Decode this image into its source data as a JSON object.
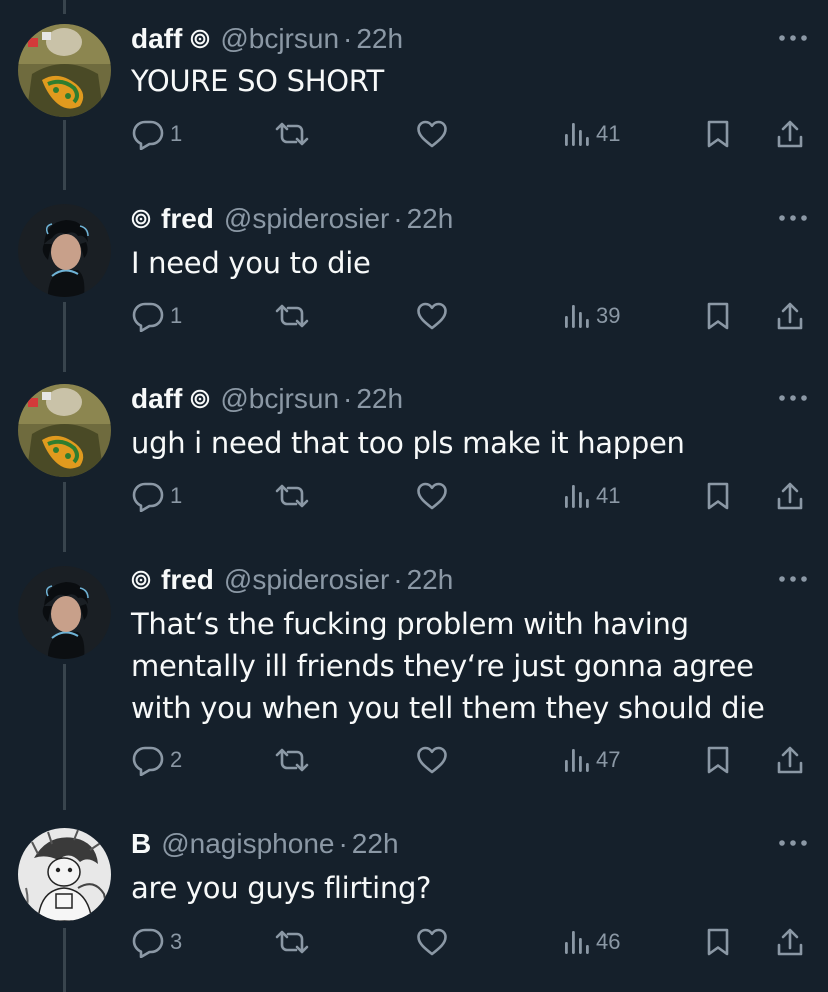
{
  "colors": {
    "background": "#15202b",
    "text": "#f7f9f9",
    "secondary": "#8b98a5",
    "thread_line": "#38444d"
  },
  "tweets": [
    {
      "name": "daff",
      "handle": "@bcjrsun",
      "separator": "·",
      "time": "22h",
      "badge": "spiral-icon",
      "badge_position": "after",
      "text": "YOURE SO SHORT",
      "replies": "1",
      "views": "41",
      "avatar": "avatar-daff"
    },
    {
      "name": "fred",
      "handle": "@spiderosier",
      "separator": "·",
      "time": "22h",
      "badge": "spiral-icon",
      "badge_position": "before",
      "text": "I need you to die",
      "replies": "1",
      "views": "39",
      "avatar": "avatar-fred"
    },
    {
      "name": "daff",
      "handle": "@bcjrsun",
      "separator": "·",
      "time": "22h",
      "badge": "spiral-icon",
      "badge_position": "after",
      "text": "ugh i need that too pls make it happen",
      "replies": "1",
      "views": "41",
      "avatar": "avatar-daff"
    },
    {
      "name": "fred",
      "handle": "@spiderosier",
      "separator": "·",
      "time": "22h",
      "badge": "spiral-icon",
      "badge_position": "before",
      "text_lines": [
        "That‘s the fucking problem with having",
        "mentally ill friends they‘re just gonna agree",
        "with you when you tell them they should die"
      ],
      "replies": "2",
      "views": "47",
      "avatar": "avatar-fred"
    },
    {
      "name": "B",
      "handle": "@nagisphone",
      "separator": "·",
      "time": "22h",
      "text": "are you guys flirting?",
      "replies": "3",
      "views": "46",
      "avatar": "avatar-b"
    }
  ]
}
